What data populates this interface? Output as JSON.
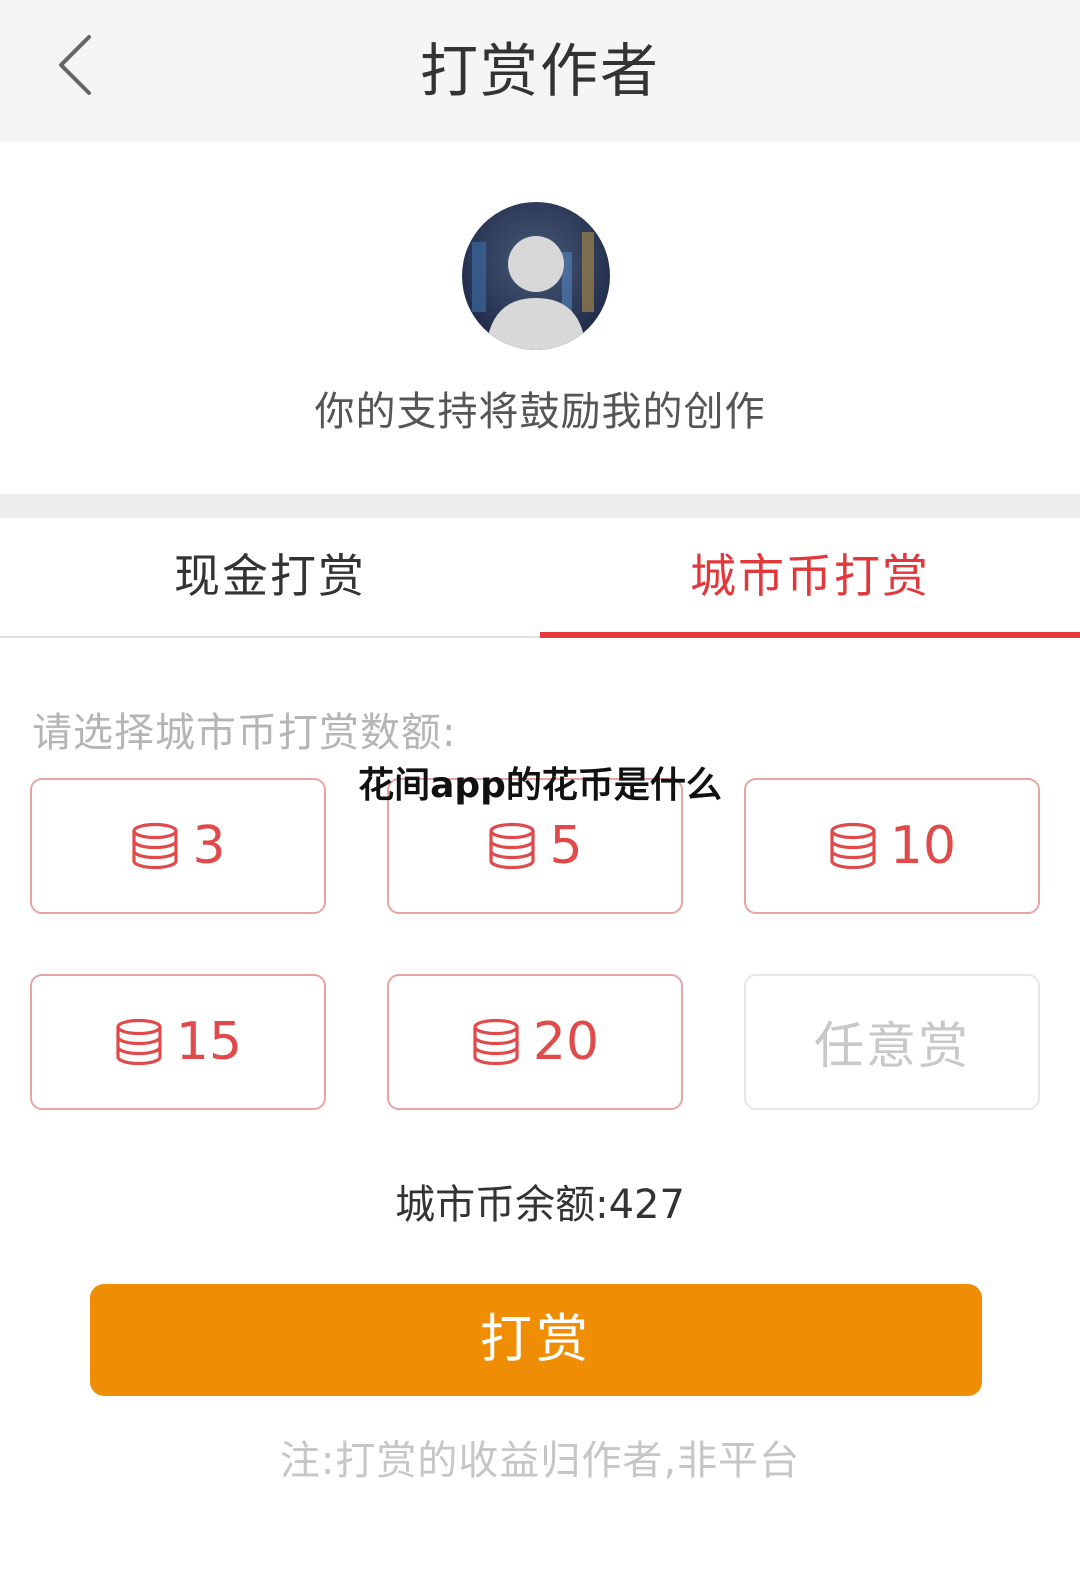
{
  "header": {
    "title": "打赏作者"
  },
  "profile": {
    "message": "你的支持将鼓励我的创作"
  },
  "tabs": [
    {
      "label": "现金打赏",
      "active": false
    },
    {
      "label": "城市币打赏",
      "active": true
    }
  ],
  "prompt": "请选择城市币打赏数额:",
  "watermark": "花间app的花币是什么",
  "amounts": [
    {
      "value": "3",
      "icon": "coin-stack-icon"
    },
    {
      "value": "5",
      "icon": "coin-stack-icon"
    },
    {
      "value": "10",
      "icon": "coin-stack-icon"
    },
    {
      "value": "15",
      "icon": "coin-stack-icon"
    },
    {
      "value": "20",
      "icon": "coin-stack-icon"
    },
    {
      "value": "任意赏"
    }
  ],
  "balance": {
    "label": "城市币余额:",
    "value": "427"
  },
  "reward_button": "打赏",
  "note": "注:打赏的收益归作者,非平台",
  "colors": {
    "accent": "#e43a3d",
    "button": "#ef8e05",
    "coin": "#e04a4a"
  }
}
